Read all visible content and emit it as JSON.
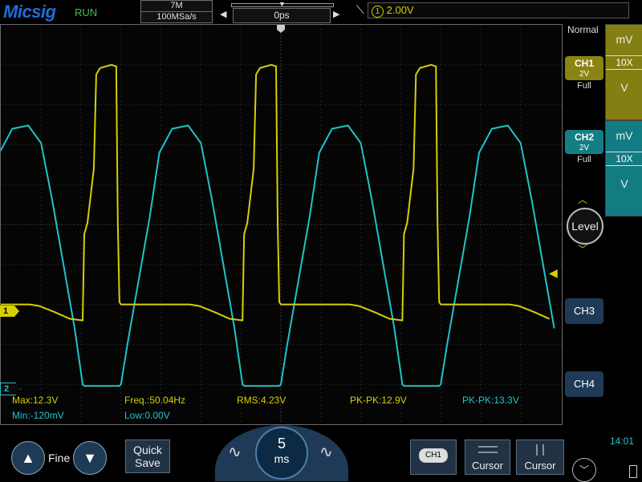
{
  "header": {
    "brand": "Micsig",
    "status": "RUN",
    "memory_depth": "7M",
    "sample_rate": "100MSa/s",
    "horizontal_delay": "0ps",
    "trigger_source": "1",
    "trigger_level": "2.00V"
  },
  "right_panel": {
    "trigger_mode": "Normal",
    "ch1": {
      "label": "CH1",
      "scale": "2V",
      "bandwidth": "Full",
      "unit": "mV",
      "probe": "10X",
      "unit_bottom": "V",
      "color": "#d7d000"
    },
    "ch2": {
      "label": "CH2",
      "scale": "2V",
      "bandwidth": "Full",
      "unit": "mV",
      "probe": "10X",
      "unit_bottom": "V",
      "color": "#20c4c9"
    },
    "level_label": "Level",
    "ch3_label": "CH3",
    "ch4_label": "CH4"
  },
  "markers": {
    "ch1_marker": "1",
    "ch2_marker": "2"
  },
  "measurements": {
    "max": "Max:12.3V",
    "min": "Min:-120mV",
    "freq": "Freq.:50.04Hz",
    "low": "Low:0.00V",
    "rms": "RMS:4.23V",
    "pkpk_ch1": "PK-PK:12.9V",
    "pkpk_ch2": "PK-PK:13.3V"
  },
  "toolbar": {
    "fine_label": "Fine",
    "quick_save_line1": "Quick",
    "quick_save_line2": "Save",
    "timebase_value": "5",
    "timebase_unit": "ms",
    "ch1_menu_label": "CH1",
    "cursor_label_a": "Cursor",
    "cursor_label_b": "Cursor",
    "clock": "14:01"
  },
  "colors": {
    "ch1": "#d7d000",
    "ch2": "#20c4c9",
    "brand": "#1e6fd9",
    "run": "#3fc34a"
  },
  "icons": [
    "up-arrow-icon",
    "down-arrow-icon",
    "sine-left-icon",
    "sine-right-icon",
    "trigger-edge-icon",
    "battery-icon"
  ]
}
